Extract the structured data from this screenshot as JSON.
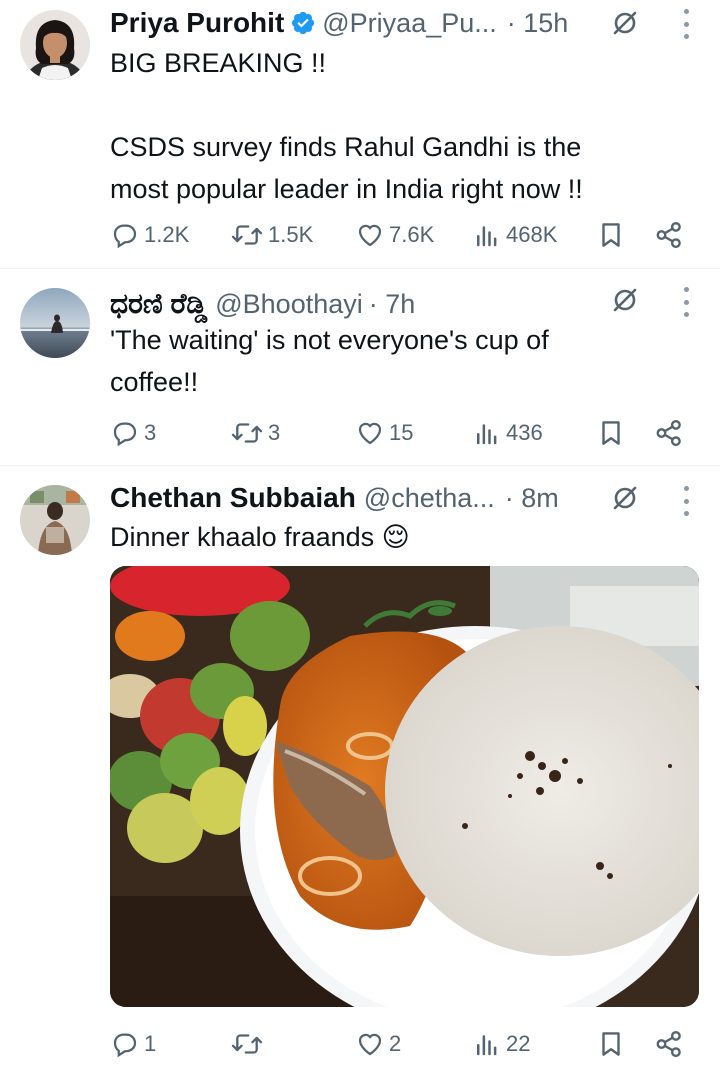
{
  "tweets": [
    {
      "name": "Priya Purohit",
      "verified": true,
      "handle": "@Priyaa_Pu...",
      "time": "· 15h",
      "text_line1": "BIG BREAKING !!",
      "text_line2": "",
      "text_line3": "CSDS survey finds Rahul Gandhi is the",
      "text_line4": "most popular leader in India right now !!",
      "replies": "1.2K",
      "reposts": "1.5K",
      "likes": "7.6K",
      "views": "468K"
    },
    {
      "name": "ಧರಣಿ ರೆಡ್ಡಿ",
      "verified": false,
      "handle": "@Bhoothayi",
      "time": "· 7h",
      "text_line1": "'The waiting' is not everyone's cup of",
      "text_line2": "coffee!!",
      "replies": "3",
      "reposts": "3",
      "likes": "15",
      "views": "436"
    },
    {
      "name": "Chethan Subbaiah",
      "verified": false,
      "handle": "@chetha...",
      "time": "· 8m",
      "text_line1": "Dinner khaalo fraands 😌",
      "replies": "1",
      "reposts": "",
      "likes": "2",
      "views": "22"
    }
  ],
  "icons": {
    "reply": "reply-icon",
    "repost": "repost-icon",
    "like": "like-icon",
    "views": "views-icon",
    "bookmark": "bookmark-icon",
    "share": "share-icon",
    "grok": "grok-icon",
    "more": "more-icon",
    "verified": "verified-badge-icon"
  },
  "colors": {
    "text": "#0f1419",
    "secondary": "#536471",
    "verified": "#1d9bf0",
    "divider": "#eff3f4"
  }
}
